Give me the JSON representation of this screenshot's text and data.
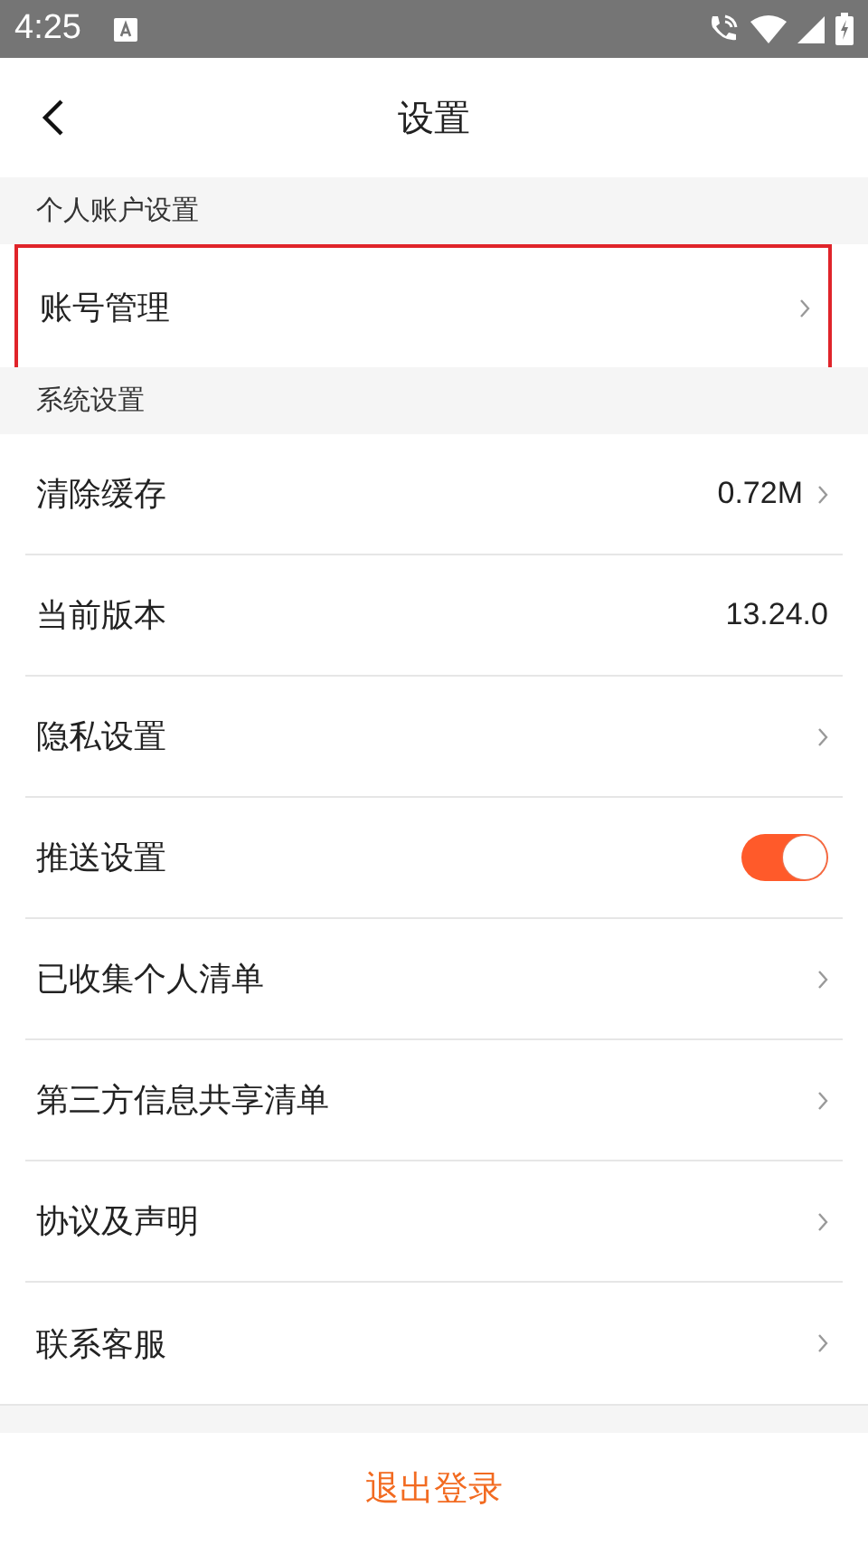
{
  "status_bar": {
    "time": "4:25"
  },
  "header": {
    "title": "设置"
  },
  "sections": [
    {
      "title": "个人账户设置",
      "items": [
        {
          "kind": "link",
          "label": "账号管理",
          "highlighted": true
        }
      ]
    },
    {
      "title": "系统设置",
      "items": [
        {
          "kind": "link",
          "label": "清除缓存",
          "value": "0.72M",
          "highlighted": false
        },
        {
          "kind": "text",
          "label": "当前版本",
          "value": "13.24.0",
          "highlighted": false
        },
        {
          "kind": "link",
          "label": "隐私设置",
          "highlighted": false
        },
        {
          "kind": "toggle",
          "label": "推送设置",
          "on": true,
          "highlighted": false
        },
        {
          "kind": "link",
          "label": "已收集个人清单",
          "highlighted": false
        },
        {
          "kind": "link",
          "label": "第三方信息共享清单",
          "highlighted": false
        },
        {
          "kind": "link",
          "label": "协议及声明",
          "highlighted": false
        },
        {
          "kind": "link",
          "label": "联系客服",
          "highlighted": false
        }
      ]
    }
  ],
  "logout_button": "退出登录"
}
